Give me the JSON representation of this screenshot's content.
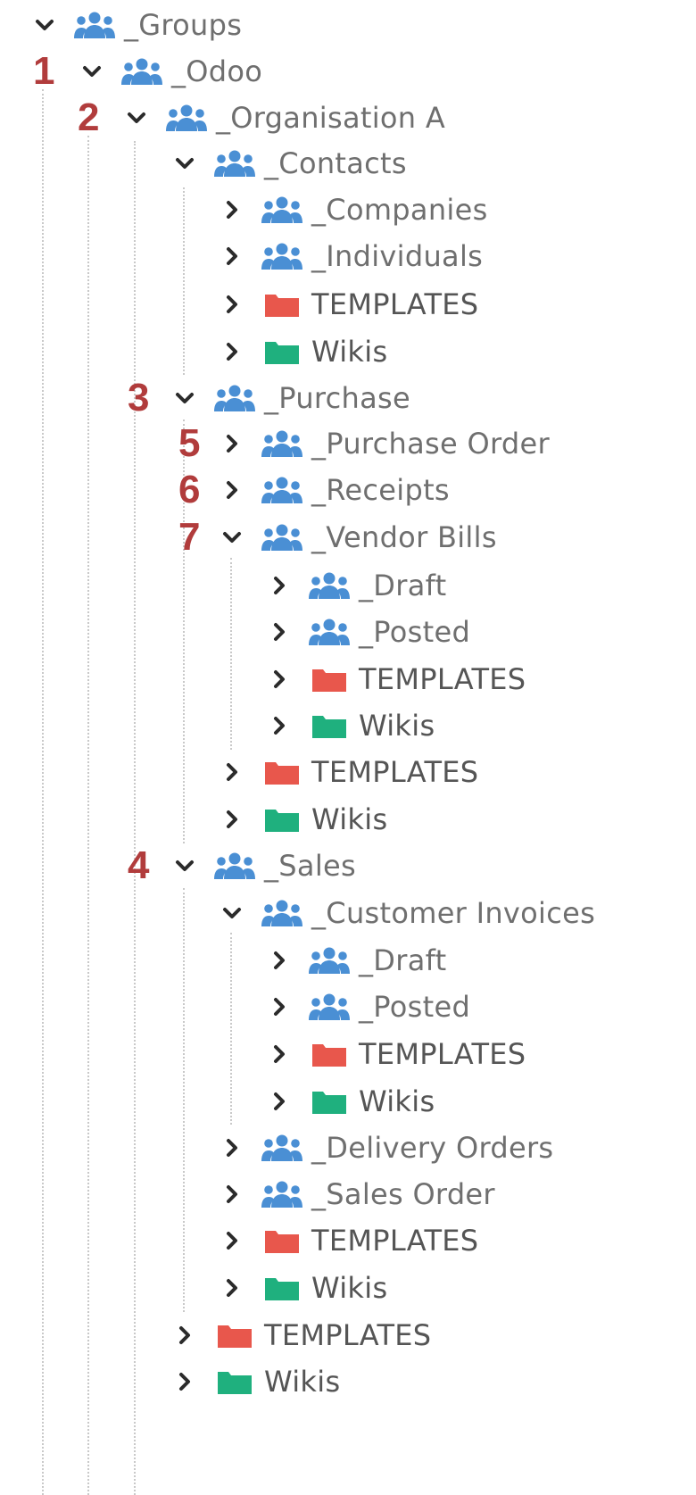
{
  "colors": {
    "group_icon": "#4a8fd4",
    "folder_templates": "#e8574c",
    "folder_wikis": "#1fb07e",
    "chevron": "#2b2b2b",
    "text": "#6f6f6f",
    "marker": "#b13c3c",
    "guide_line": "#c9c9c9"
  },
  "tree": [
    {
      "label": "_Groups",
      "icon": "group-icon",
      "expanded": true
    },
    {
      "label": "_Odoo",
      "icon": "group-icon",
      "expanded": true,
      "marker": "1"
    },
    {
      "label": "_Organisation A",
      "icon": "group-icon",
      "expanded": true,
      "marker": "2"
    },
    {
      "label": "_Contacts",
      "icon": "group-icon",
      "expanded": true
    },
    {
      "label": "_Companies",
      "icon": "group-icon",
      "expanded": false
    },
    {
      "label": "_Individuals",
      "icon": "group-icon",
      "expanded": false
    },
    {
      "label": "TEMPLATES",
      "icon": "folder-red-icon",
      "expanded": false
    },
    {
      "label": "Wikis",
      "icon": "folder-green-icon",
      "expanded": false
    },
    {
      "label": "_Purchase",
      "icon": "group-icon",
      "expanded": true,
      "marker": "3"
    },
    {
      "label": "_Purchase Order",
      "icon": "group-icon",
      "expanded": false,
      "marker": "5"
    },
    {
      "label": "_Receipts",
      "icon": "group-icon",
      "expanded": false,
      "marker": "6"
    },
    {
      "label": "_Vendor Bills",
      "icon": "group-icon",
      "expanded": true,
      "marker": "7"
    },
    {
      "label": "_Draft",
      "icon": "group-icon",
      "expanded": false
    },
    {
      "label": "_Posted",
      "icon": "group-icon",
      "expanded": false
    },
    {
      "label": "TEMPLATES",
      "icon": "folder-red-icon",
      "expanded": false
    },
    {
      "label": "Wikis",
      "icon": "folder-green-icon",
      "expanded": false
    },
    {
      "label": "TEMPLATES",
      "icon": "folder-red-icon",
      "expanded": false
    },
    {
      "label": "Wikis",
      "icon": "folder-green-icon",
      "expanded": false
    },
    {
      "label": "_Sales",
      "icon": "group-icon",
      "expanded": true,
      "marker": "4"
    },
    {
      "label": "_Customer Invoices",
      "icon": "group-icon",
      "expanded": true
    },
    {
      "label": "_Draft",
      "icon": "group-icon",
      "expanded": false
    },
    {
      "label": "_Posted",
      "icon": "group-icon",
      "expanded": false
    },
    {
      "label": "TEMPLATES",
      "icon": "folder-red-icon",
      "expanded": false
    },
    {
      "label": "Wikis",
      "icon": "folder-green-icon",
      "expanded": false
    },
    {
      "label": "_Delivery Orders",
      "icon": "group-icon",
      "expanded": false
    },
    {
      "label": "_Sales Order",
      "icon": "group-icon",
      "expanded": false
    },
    {
      "label": "TEMPLATES",
      "icon": "folder-red-icon",
      "expanded": false
    },
    {
      "label": "Wikis",
      "icon": "folder-green-icon",
      "expanded": false
    },
    {
      "label": "TEMPLATES",
      "icon": "folder-red-icon",
      "expanded": false
    },
    {
      "label": "Wikis",
      "icon": "folder-green-icon",
      "expanded": false
    }
  ]
}
